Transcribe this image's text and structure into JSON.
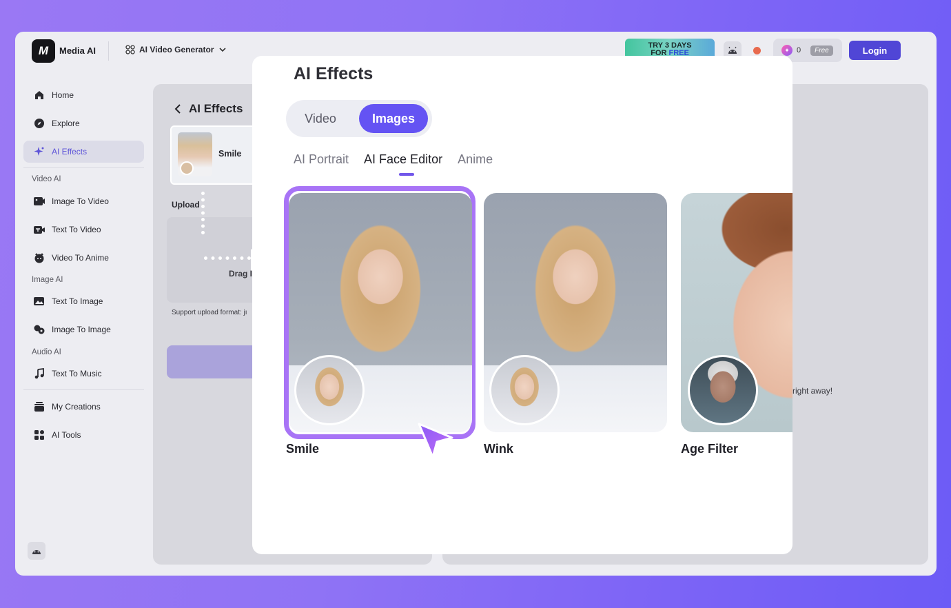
{
  "header": {
    "logo_text": "M",
    "app_name": "Media AI",
    "generator_menu": "AI Video Generator",
    "banner_line1": "TRY 3 DAYS",
    "banner_line2_prefix": "FOR ",
    "banner_line2_free": "FREE",
    "credits": "0",
    "plan_badge": "Free",
    "login_label": "Login"
  },
  "sidebar": {
    "items": [
      {
        "label": "Home",
        "icon": "home-icon"
      },
      {
        "label": "Explore",
        "icon": "compass-icon"
      },
      {
        "label": "AI Effects",
        "icon": "sparkle-icon"
      }
    ],
    "sections": {
      "video_ai": "Video AI",
      "image_ai": "Image AI",
      "audio_ai": "Audio AI"
    },
    "video_items": [
      {
        "label": "Image To Video",
        "icon": "image-video-icon"
      },
      {
        "label": "Text To Video",
        "icon": "text-video-icon"
      },
      {
        "label": "Video To Anime",
        "icon": "anime-icon"
      }
    ],
    "image_items": [
      {
        "label": "Text To Image",
        "icon": "text-image-icon"
      },
      {
        "label": "Image To Image",
        "icon": "image-image-icon"
      }
    ],
    "audio_items": [
      {
        "label": "Text To Music",
        "icon": "music-note-icon"
      }
    ],
    "bottom_items": [
      {
        "label": "My Creations",
        "icon": "stack-icon"
      },
      {
        "label": "AI Tools",
        "icon": "tools-grid-icon"
      }
    ]
  },
  "left_panel": {
    "back_title": "AI Effects",
    "selected_effect": "Smile",
    "upload_label": "Upload",
    "drop_text": "Drag I",
    "support_text": "Support upload format: jı"
  },
  "right_panel": {
    "partial_text": "right away!"
  },
  "modal": {
    "title": "AI Effects",
    "segments": {
      "video": "Video",
      "images": "Images",
      "active": "Images"
    },
    "subtabs": [
      "AI Portrait",
      "AI Face Editor",
      "Anime"
    ],
    "active_subtab": "AI Face Editor",
    "cards": [
      {
        "label": "Smile",
        "selected": true
      },
      {
        "label": "Wink",
        "selected": false
      },
      {
        "label": "Age Filter",
        "selected": false
      }
    ]
  },
  "colors": {
    "accent": "#6453f3",
    "selection_frame": "#a874f6",
    "login_button": "#5046d6"
  }
}
